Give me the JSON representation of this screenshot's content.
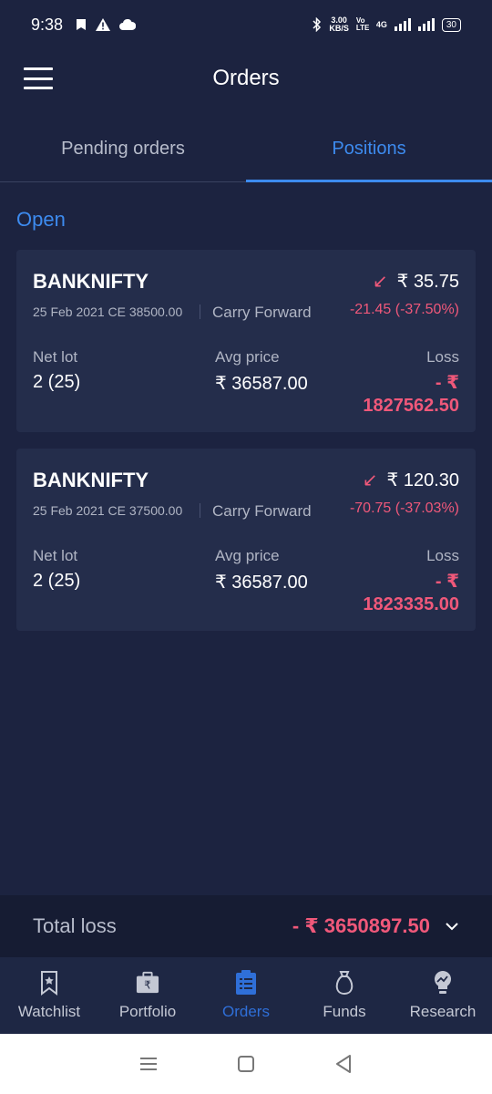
{
  "status": {
    "time": "9:38",
    "net_speed_value": "3.00",
    "net_speed_unit": "KB/S",
    "volte": "Vo LTE",
    "network": "4G",
    "battery": "30"
  },
  "header": {
    "title": "Orders"
  },
  "tabs": [
    {
      "label": "Pending orders",
      "active": false
    },
    {
      "label": "Positions",
      "active": true
    }
  ],
  "section": {
    "label": "Open"
  },
  "positions": [
    {
      "symbol": "BANKNIFTY",
      "contract": "25 Feb 2021 CE 38500.00",
      "product": "Carry Forward",
      "ltp": "₹ 35.75",
      "change": "-21.45 (-37.50%)",
      "net_lot_label": "Net lot",
      "net_lot": "2 (25)",
      "avg_label": "Avg price",
      "avg_price": "₹ 36587.00",
      "pnl_label": "Loss",
      "pnl_line1": "- ₹",
      "pnl_line2": "1827562.50"
    },
    {
      "symbol": "BANKNIFTY",
      "contract": "25 Feb 2021 CE 37500.00",
      "product": "Carry Forward",
      "ltp": "₹ 120.30",
      "change": "-70.75 (-37.03%)",
      "net_lot_label": "Net lot",
      "net_lot": "2 (25)",
      "avg_label": "Avg price",
      "avg_price": "₹ 36587.00",
      "pnl_label": "Loss",
      "pnl_line1": "- ₹",
      "pnl_line2": "1823335.00"
    }
  ],
  "total": {
    "label": "Total loss",
    "value": "- ₹ 3650897.50"
  },
  "bottom_nav": [
    {
      "label": "Watchlist",
      "icon": "bookmark-star-icon",
      "active": false
    },
    {
      "label": "Portfolio",
      "icon": "briefcase-rupee-icon",
      "active": false
    },
    {
      "label": "Orders",
      "icon": "clipboard-list-icon",
      "active": true
    },
    {
      "label": "Funds",
      "icon": "money-bag-icon",
      "active": false
    },
    {
      "label": "Research",
      "icon": "lightbulb-chart-icon",
      "active": false
    }
  ],
  "colors": {
    "background": "#1c2340",
    "card": "#242d4b",
    "accent": "#3d8bef",
    "loss": "#f0587a"
  }
}
